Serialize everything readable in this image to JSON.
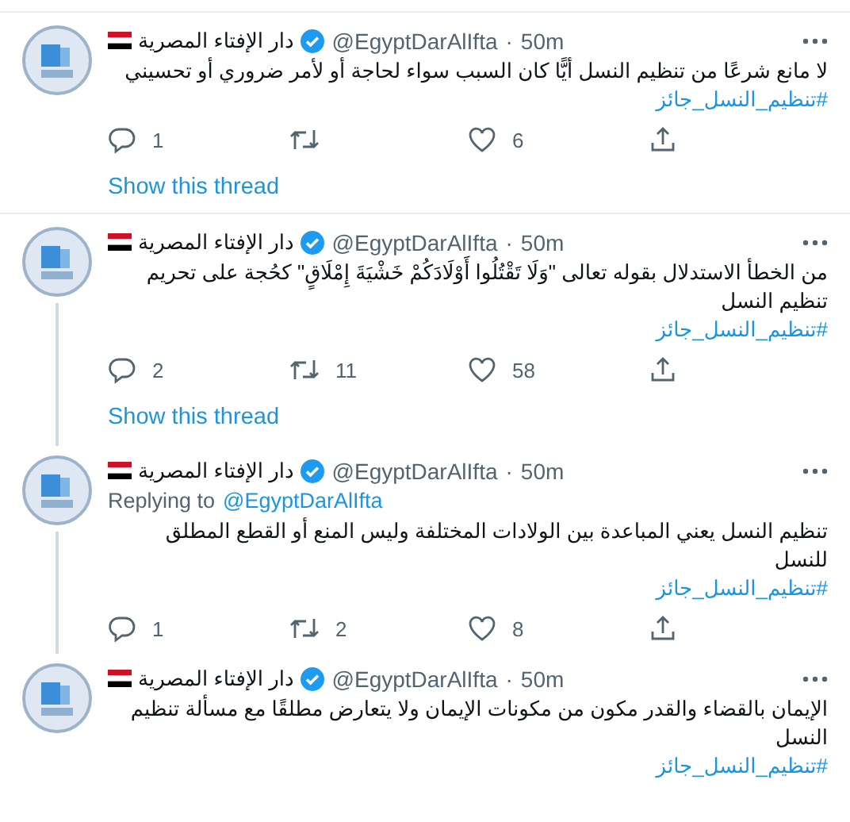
{
  "tweets": [
    {
      "name": "دار الإفتاء المصرية",
      "handle": "@EgyptDarAlIfta",
      "separator": "·",
      "time": "50m",
      "text": "لا مانع شرعًا من تنظيم النسل أيًّا كان السبب سواء لحاجة أو لأمر ضروري أو تحسيني",
      "hashtag": "#تنظيم_النسل_جائز",
      "replies": "1",
      "likes": "6",
      "show_thread": "Show this thread",
      "thread_below": false
    },
    {
      "name": "دار الإفتاء المصرية",
      "handle": "@EgyptDarAlIfta",
      "separator": "·",
      "time": "50m",
      "text": "من الخطأ الاستدلال بقوله تعالى \"وَلَا تَقْتُلُوا أَوْلَادَكُمْ خَشْيَةَ إِمْلَاقٍ\" كحُجة على تحريم تنظيم النسل",
      "hashtag": "#تنظيم_النسل_جائز",
      "replies": "2",
      "retweets": "11",
      "likes": "58",
      "show_thread": "Show this thread",
      "thread_below": true
    },
    {
      "name": "دار الإفتاء المصرية",
      "handle": "@EgyptDarAlIfta",
      "separator": "·",
      "time": "50m",
      "replying_to": {
        "label": "Replying to",
        "handle": "@EgyptDarAlIfta"
      },
      "text": "تنظيم النسل يعني المباعدة بين الولادات المختلفة وليس المنع أو القطع المطلق للنسل",
      "hashtag": "#تنظيم_النسل_جائز",
      "replies": "1",
      "retweets": "2",
      "likes": "8",
      "thread_below": true
    },
    {
      "name": "دار الإفتاء المصرية",
      "handle": "@EgyptDarAlIfta",
      "separator": "·",
      "time": "50m",
      "text": "الإيمان بالقضاء والقدر مكون من مكونات الإيمان ولا يتعارض مطلقًا مع مسألة تنظيم النسل",
      "hashtag": "#تنظيم_النسل_جائز",
      "thread_below": false
    }
  ]
}
